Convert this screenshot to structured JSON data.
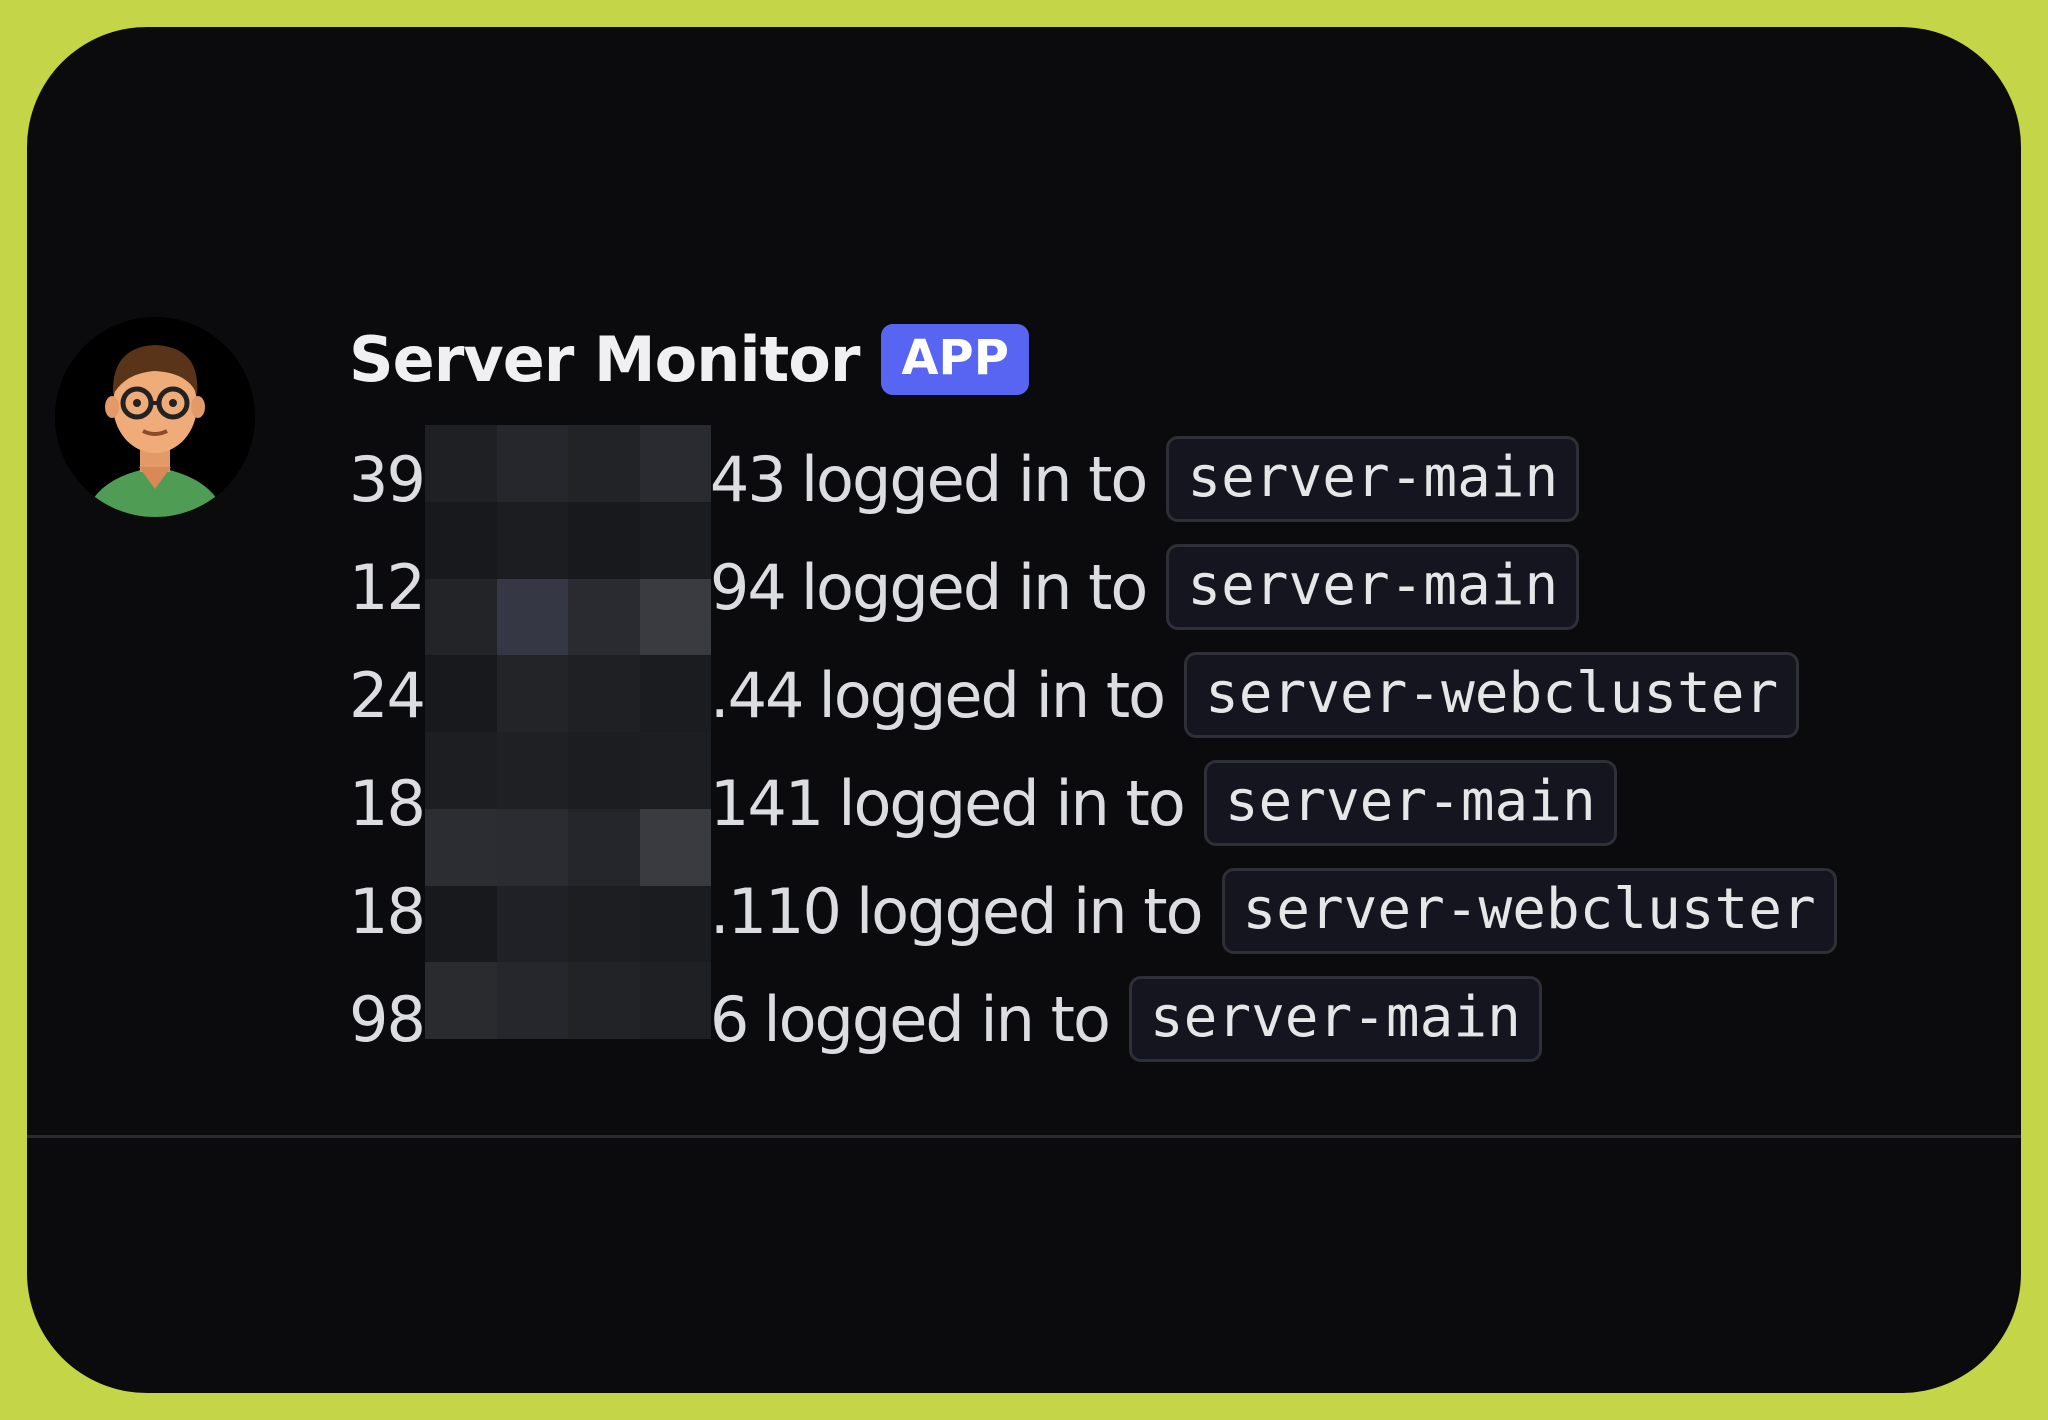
{
  "message": {
    "author": "Server Monitor",
    "badge": "APP",
    "lines": [
      {
        "ip_prefix": "39",
        "ip_suffix": "43",
        "text": "logged in to",
        "server": "server-main"
      },
      {
        "ip_prefix": "12",
        "ip_suffix": "94",
        "text": "logged in to",
        "server": "server-main"
      },
      {
        "ip_prefix": "24",
        "ip_suffix": ".44",
        "text": "logged in to",
        "server": "server-webcluster"
      },
      {
        "ip_prefix": "18",
        "ip_suffix": "141",
        "text": "logged in to",
        "server": "server-main"
      },
      {
        "ip_prefix": "18",
        "ip_suffix": ".110",
        "text": "logged in to",
        "server": "server-webcluster"
      },
      {
        "ip_prefix": "98",
        "ip_suffix": "6",
        "text": "logged in to",
        "server": "server-main"
      }
    ]
  },
  "colors": {
    "frame_border": "#c4d647",
    "background": "#0b0b0d",
    "badge": "#5865f2",
    "code_bg": "#14151f"
  },
  "icons": {
    "avatar": "avatar-icon"
  }
}
